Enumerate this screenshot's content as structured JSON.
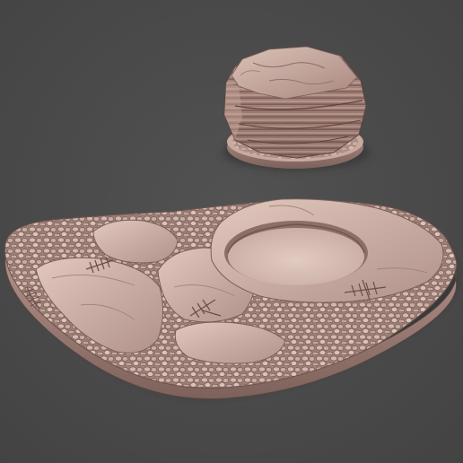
{
  "scene": {
    "background_color": "#4b4b4b",
    "material_colors": {
      "stone_light": "#d9beb4",
      "stone_mid": "#b89a90",
      "stone_dark": "#7a5f58",
      "stone_shadow": "#5a4440",
      "base_rim": "#a88880",
      "hole_fill": "#dcc4bb"
    },
    "objects": [
      {
        "name": "stacked-boulder-on-round-base",
        "icon": "boulder-icon"
      },
      {
        "name": "rocky-terrain-base-with-hole",
        "icon": "terrain-icon"
      }
    ]
  }
}
